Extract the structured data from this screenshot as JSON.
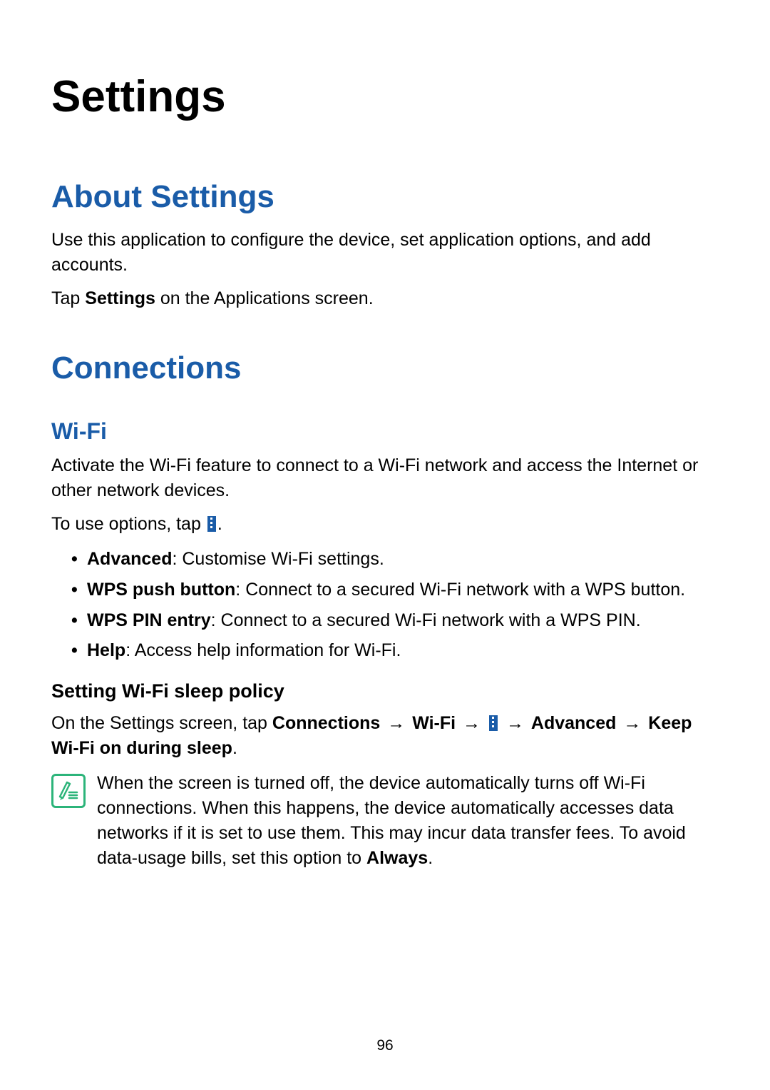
{
  "pageTitle": "Settings",
  "aboutSettings": {
    "heading": "About Settings",
    "para1": "Use this application to configure the device, set application options, and add accounts.",
    "para2_pre": "Tap ",
    "para2_bold": "Settings",
    "para2_post": " on the Applications screen."
  },
  "connections": {
    "heading": "Connections",
    "wifi": {
      "heading": "Wi-Fi",
      "para1": "Activate the Wi-Fi feature to connect to a Wi-Fi network and access the Internet or other network devices.",
      "para2_pre": "To use options, tap ",
      "para2_post": ".",
      "bullets": [
        {
          "bold": "Advanced",
          "text": ": Customise Wi-Fi settings."
        },
        {
          "bold": "WPS push button",
          "text": ": Connect to a secured Wi-Fi network with a WPS button."
        },
        {
          "bold": "WPS PIN entry",
          "text": ": Connect to a secured Wi-Fi network with a WPS PIN."
        },
        {
          "bold": "Help",
          "text": ": Access help information for Wi-Fi."
        }
      ],
      "sleepPolicy": {
        "heading": "Setting Wi-Fi sleep policy",
        "path_pre": "On the Settings screen, tap ",
        "path_connections": "Connections",
        "path_wifi": "Wi-Fi",
        "path_advanced": "Advanced",
        "path_keep": "Keep Wi-Fi on during sleep",
        "path_period": ".",
        "arrow": "→",
        "note_text": "When the screen is turned off, the device automatically turns off Wi-Fi connections. When this happens, the device automatically accesses data networks if it is set to use them. This may incur data transfer fees. To avoid data-usage bills, set this option to ",
        "note_bold": "Always",
        "note_period": "."
      }
    }
  },
  "pageNumber": "96"
}
